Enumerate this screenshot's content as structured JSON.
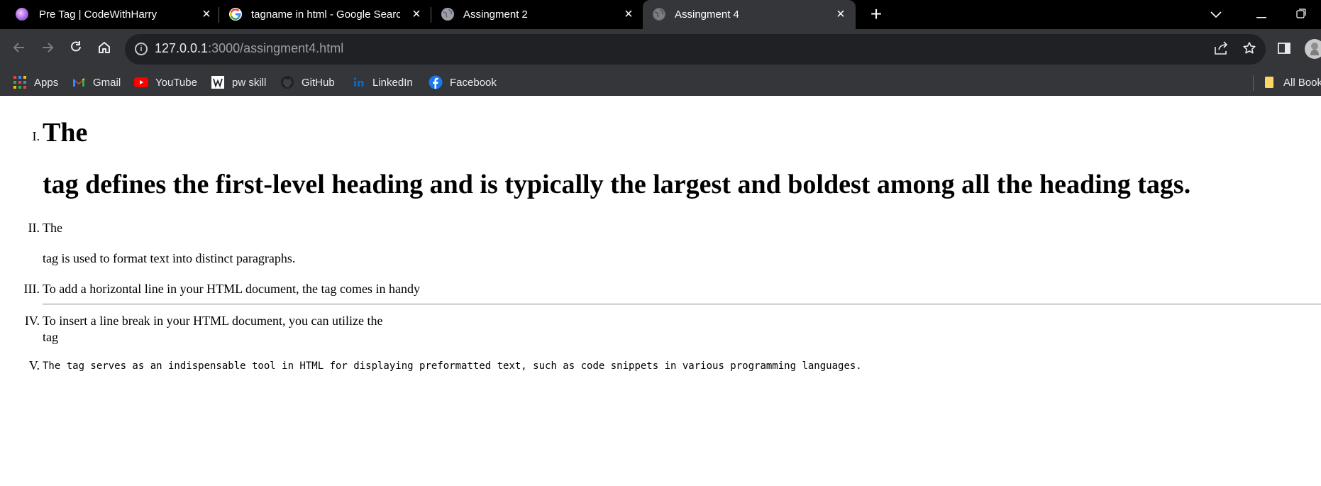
{
  "browser": {
    "tabs": [
      {
        "title": "Pre Tag | CodeWithHarry",
        "favicon": "codewithharry-icon",
        "active": false
      },
      {
        "title": "tagname in html - Google Search",
        "favicon": "google-icon",
        "active": false
      },
      {
        "title": "Assingment 2",
        "favicon": "globe-icon",
        "active": false
      },
      {
        "title": "Assingment 4",
        "favicon": "globe-icon",
        "active": true
      }
    ],
    "address": {
      "host": "127.0.0.1",
      "rest": ":3000/assingment4.html"
    },
    "bookmarks": [
      {
        "label": "Apps",
        "icon": "apps-grid-icon"
      },
      {
        "label": "Gmail",
        "icon": "gmail-icon"
      },
      {
        "label": "YouTube",
        "icon": "youtube-icon"
      },
      {
        "label": "pw skill",
        "icon": "pw-skill-icon"
      },
      {
        "label": "GitHub",
        "icon": "github-icon"
      },
      {
        "label": "LinkedIn",
        "icon": "linkedin-icon"
      },
      {
        "label": "Facebook",
        "icon": "facebook-icon"
      },
      {
        "label": "All Bookmarks",
        "icon": "folder-icon"
      }
    ],
    "colors": {
      "tab_strip": "#000000",
      "toolbar": "#35363a",
      "omnibox": "#202124",
      "text": "#e8eaed"
    }
  },
  "page": {
    "list": [
      {
        "marker": "I.",
        "lines": [
          "The",
          "tag defines the first-level heading and is typically the largest and boldest among all the heading tags."
        ]
      },
      {
        "marker": "II.",
        "lines": [
          "The",
          "tag is used to format text into distinct paragraphs."
        ]
      },
      {
        "marker": "III.",
        "lines": [
          "To add a horizontal line in your HTML document, the tag comes in handy"
        ]
      },
      {
        "marker": "IV.",
        "lines": [
          "To insert a line break in your HTML document, you can utilize the",
          "tag"
        ]
      },
      {
        "marker": "V.",
        "lines": [
          "The  tag serves as an indispensable tool in HTML for displaying preformatted text, such as code snippets in various programming languages."
        ]
      }
    ]
  }
}
